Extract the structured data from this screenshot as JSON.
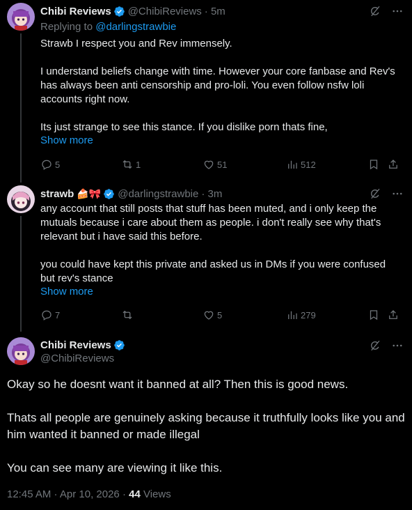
{
  "tweet1": {
    "display_name": "Chibi Reviews",
    "handle": "@ChibiReviews",
    "time": "· 5m",
    "replying_prefix": "Replying to ",
    "replying_to": "@darlingstrawbie",
    "text": "Strawb I respect you and Rev immensely.\n\nI understand beliefs change with time. However your core fanbase and Rev's has always been anti censorship and pro-loli. You even follow nsfw loli accounts right now.\n\nIts just strange to see this stance. If you dislike porn thats fine,",
    "show_more": "Show more",
    "replies": "5",
    "reposts": "1",
    "likes": "51",
    "views": "512"
  },
  "tweet2": {
    "display_name": "strawb",
    "name_emojis": "🍰🎀",
    "handle": "@darlingstrawbie",
    "time": "· 3m",
    "text": "any account that still posts that stuff has been muted, and i only keep the mutuals because i care about them as people. i don't really see why that's relevant but i have said this before.\n\nyou could have kept this private and asked us in DMs if you were confused but rev's stance",
    "show_more": "Show more",
    "replies": "7",
    "reposts": "",
    "likes": "5",
    "views": "279"
  },
  "main_tweet": {
    "display_name": "Chibi Reviews",
    "handle": "@ChibiReviews",
    "text": "Okay so he doesnt want it banned at all? Then this is good news.\n\nThats all people are genuinely asking because it truthfully looks like you and him wanted it banned or made illegal\n\nYou can see many are viewing it like this.",
    "timestamp": "12:45 AM · Apr 10, 2026 · ",
    "view_count": "44",
    "views_label": " Views"
  },
  "colors": {
    "accent": "#1d9bf0",
    "background": "#000000",
    "muted": "#71767b",
    "text": "#e7e9ea"
  }
}
